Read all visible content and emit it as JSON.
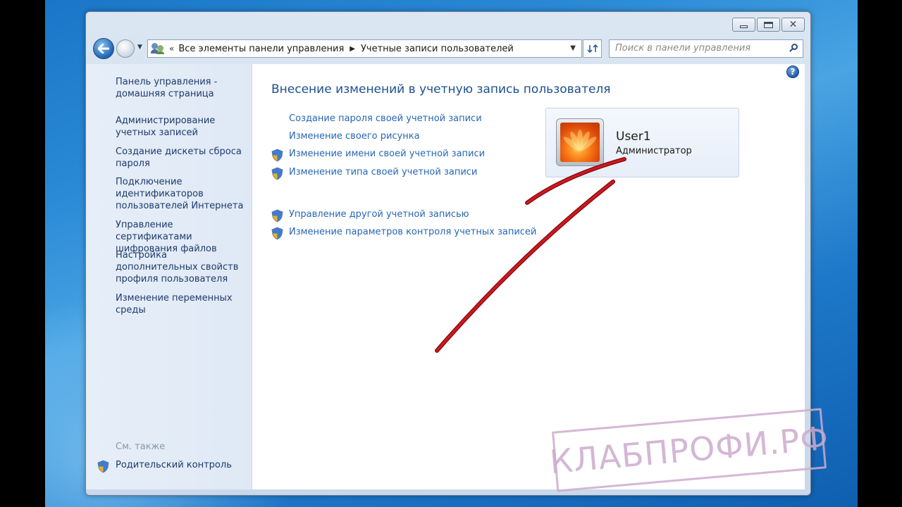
{
  "window": {
    "caption": {
      "minimize": "minimize",
      "maximize": "maximize",
      "close": "✕"
    }
  },
  "navbar": {
    "back": "back",
    "forward": "forward",
    "breadcrumb": [
      "Все элементы панели управления",
      "Учетные записи пользователей"
    ],
    "search_placeholder": "Поиск в панели управления"
  },
  "sidebar": {
    "items": [
      {
        "label": "Панель управления - домашняя страница"
      },
      {
        "label": "Администрирование учетных записей"
      },
      {
        "label": "Создание дискеты сброса пароля"
      },
      {
        "label": "Подключение идентификаторов пользователей Интернета"
      },
      {
        "label": "Управление сертификатами шифрования файлов"
      },
      {
        "label": "Настройка дополнительных свойств профиля пользователя"
      },
      {
        "label": "Изменение переменных среды"
      }
    ],
    "see_also": "См. также",
    "parental_control": "Родительский контроль"
  },
  "main": {
    "title": "Внесение изменений в учетную запись пользователя",
    "tasks": [
      {
        "label": "Создание пароля своей учетной записи",
        "shield": false
      },
      {
        "label": "Изменение своего рисунка",
        "shield": false
      },
      {
        "label": "Изменение имени своей учетной записи",
        "shield": true
      },
      {
        "label": "Изменение типа своей учетной записи",
        "shield": true
      },
      {
        "label": "Управление другой учетной записью",
        "shield": true
      },
      {
        "label": "Изменение параметров контроля учетных записей",
        "shield": true
      }
    ],
    "help": "?",
    "user": {
      "name": "User1",
      "role": "Администратор"
    }
  },
  "watermark": "КЛАБПРОФИ.РФ",
  "colors": {
    "link": "#2766b5",
    "sidebar_link": "#1e3a6a",
    "title": "#1e4f8f",
    "annotation": "#c8141e",
    "watermark": "#cdaacd"
  }
}
